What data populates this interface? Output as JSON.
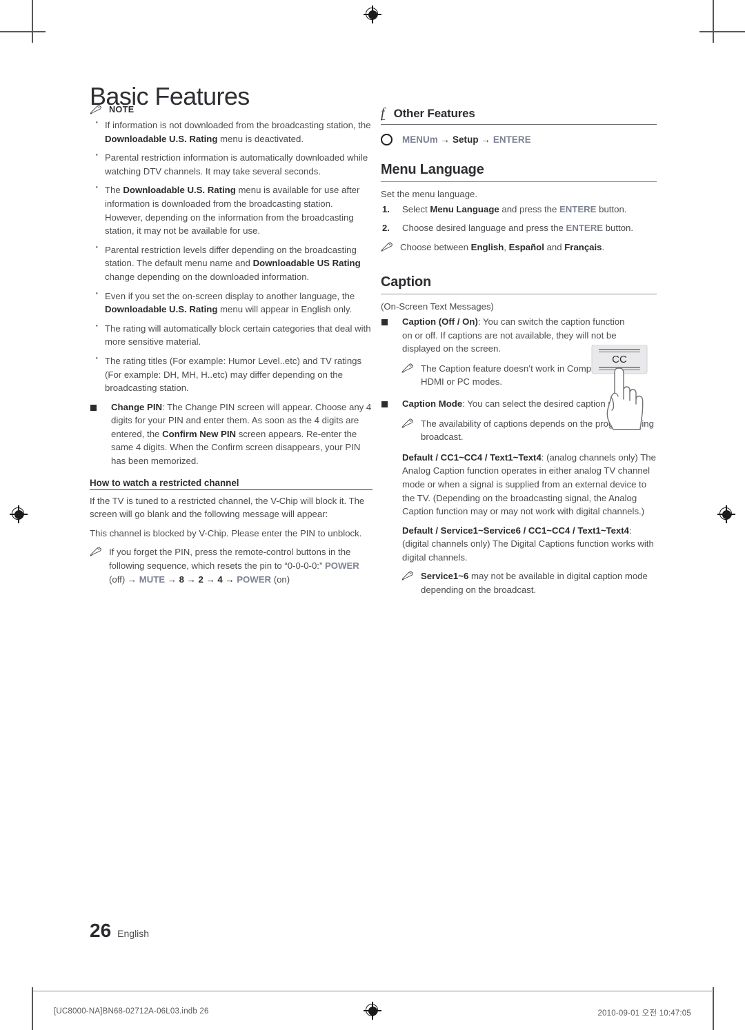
{
  "page": {
    "title": "Basic Features",
    "number": "26",
    "language_label": "English",
    "footer_left": "[UC8000-NA]BN68-02712A-06L03.indb   26",
    "footer_right": "2010-09-01   오전 10:47:05"
  },
  "left_column": {
    "note_label": "NOTE",
    "note_icon": "pencil-icon",
    "bullets": [
      {
        "runs": [
          {
            "t": "If information is not downloaded from the broadcasting station, the ",
            "b": false
          },
          {
            "t": "Downloadable U.S. Rating",
            "b": true
          },
          {
            "t": " menu is deactivated.",
            "b": false
          }
        ]
      },
      {
        "runs": [
          {
            "t": "Parental restriction information is automatically downloaded while watching DTV channels. It may take several seconds.",
            "b": false
          }
        ]
      },
      {
        "runs": [
          {
            "t": "The ",
            "b": false
          },
          {
            "t": "Downloadable U.S. Rating",
            "b": true
          },
          {
            "t": " menu is available for use after information is downloaded from the broadcasting station. However, depending on the information from the broadcasting station, it may not be available for use.",
            "b": false
          }
        ]
      },
      {
        "runs": [
          {
            "t": "Parental restriction levels differ depending on the broadcasting station. The default menu name and ",
            "b": false
          },
          {
            "t": "Downloadable US Rating",
            "b": true
          },
          {
            "t": " change depending on the downloaded information.",
            "b": false
          }
        ]
      },
      {
        "runs": [
          {
            "t": "Even if you set the on-screen display to another language, the ",
            "b": false
          },
          {
            "t": "Downloadable U.S. Rating",
            "b": true
          },
          {
            "t": " menu will appear in English only.",
            "b": false
          }
        ]
      },
      {
        "runs": [
          {
            "t": "The rating will automatically block certain categories that deal with more sensitive material.",
            "b": false
          }
        ]
      },
      {
        "runs": [
          {
            "t": "The rating titles (For example: Humor Level..etc) and TV ratings (For example: DH, MH, H..etc) may differ depending on the broadcasting station.",
            "b": false
          }
        ]
      }
    ],
    "change_pin": {
      "runs": [
        {
          "t": "Change PIN",
          "b": true
        },
        {
          "t": ": The Change PIN screen will appear. Choose any 4 digits for your PIN and enter them. As soon as the 4 digits are entered, the ",
          "b": false
        },
        {
          "t": "Confirm New PIN",
          "b": true
        },
        {
          "t": " screen appears. Re-enter the same 4 digits. When the Confirm screen disappears, your PIN has been memorized.",
          "b": false
        }
      ]
    },
    "restricted": {
      "heading": "How to watch a restricted channel",
      "para1": "If the TV is tuned to a restricted channel, the V-Chip will block it. The screen will go blank and the following message will appear:",
      "para2": "This channel is blocked by V-Chip. Please enter the PIN to unblock.",
      "note_runs": [
        {
          "t": "If you forget the PIN, press the remote-control buttons in the following sequence, which resets the pin to “0-0-0-0:” ",
          "b": false,
          "k": false
        },
        {
          "t": "POWER",
          "b": true,
          "k": true
        },
        {
          "t": " (off) → ",
          "b": false,
          "k": false
        },
        {
          "t": "MUTE",
          "b": true,
          "k": true
        },
        {
          "t": " → ",
          "b": false,
          "k": false
        },
        {
          "t": "8",
          "b": true,
          "k": false
        },
        {
          "t": " → ",
          "b": true,
          "k": false
        },
        {
          "t": "2",
          "b": true,
          "k": false
        },
        {
          "t": " → ",
          "b": true,
          "k": false
        },
        {
          "t": "4",
          "b": true,
          "k": false
        },
        {
          "t": " → ",
          "b": true,
          "k": false
        },
        {
          "t": "POWER",
          "b": true,
          "k": true
        },
        {
          "t": " (on)",
          "b": false,
          "k": false
        }
      ]
    }
  },
  "right_column": {
    "feature_glyph": "f",
    "feature_title": "Other Features",
    "menu_path": {
      "icon": "circle-icon",
      "runs": [
        {
          "t": "MENUm",
          "k": true
        },
        {
          "t": "  → ",
          "k": false
        },
        {
          "t": "Setup",
          "k": false
        },
        {
          "t": " → ",
          "k": false
        },
        {
          "t": "ENTERE",
          "k": true
        }
      ]
    },
    "menu_language": {
      "heading": "Menu Language",
      "intro": "Set the menu language.",
      "steps": [
        {
          "runs": [
            {
              "t": "Select ",
              "b": false,
              "k": false
            },
            {
              "t": "Menu Language",
              "b": true,
              "k": false
            },
            {
              "t": " and press the ",
              "b": false,
              "k": false
            },
            {
              "t": "ENTERE",
              "b": true,
              "k": true
            },
            {
              "t": " button.",
              "b": false,
              "k": false
            }
          ]
        },
        {
          "runs": [
            {
              "t": "Choose desired language and press the ",
              "b": false,
              "k": false
            },
            {
              "t": "ENTERE",
              "b": true,
              "k": true
            },
            {
              "t": " button.",
              "b": false,
              "k": false
            }
          ]
        }
      ],
      "note_runs": [
        {
          "t": "Choose between ",
          "b": false
        },
        {
          "t": "English",
          "b": true
        },
        {
          "t": ", ",
          "b": false
        },
        {
          "t": "Español",
          "b": true
        },
        {
          "t": " and ",
          "b": false
        },
        {
          "t": "Français",
          "b": true
        },
        {
          "t": ".",
          "b": false
        }
      ]
    },
    "caption": {
      "heading": "Caption",
      "subtitle": "(On-Screen Text Messages)",
      "item1_runs": [
        {
          "t": "Caption (Off / On)",
          "b": true
        },
        {
          "t": ": You can switch the caption function on or off. If captions are not available, they will not be displayed on the screen.",
          "b": false
        }
      ],
      "item1_note": "The Caption feature doesn’t work in Component, HDMI or PC modes.",
      "item2_runs": [
        {
          "t": "Caption Mode",
          "b": true
        },
        {
          "t": ": You can select the desired caption mode.",
          "b": false
        }
      ],
      "item2_note": "The availability of captions depends on the program being broadcast.",
      "analog_runs": [
        {
          "t": "Default / CC1~CC4 / Text1~Text4",
          "b": true
        },
        {
          "t": ": (analog channels only) The Analog Caption function operates in either analog TV channel mode or when a signal is supplied from an external device to the TV. (Depending on the broadcasting signal, the Analog Caption function may or may not work with digital channels.)",
          "b": false
        }
      ],
      "digital_runs": [
        {
          "t": "Default / Service1~Service6 / CC1~CC4 / Text1~Text4",
          "b": true
        },
        {
          "t": ": (digital channels only) The Digital Captions function works with digital channels.",
          "b": false
        }
      ],
      "digital_note_runs": [
        {
          "t": "Service1~6",
          "b": true
        },
        {
          "t": " may not be available in digital caption mode depending on the broadcast.",
          "b": false
        }
      ],
      "illustration": {
        "button_label": "CC",
        "name": "cc-remote-button-illustration"
      }
    }
  },
  "colors": {
    "key_accent": "#7d8392",
    "body_text": "#4b4b50",
    "bold_text": "#2d2d31",
    "rule": "#8e8e93"
  }
}
